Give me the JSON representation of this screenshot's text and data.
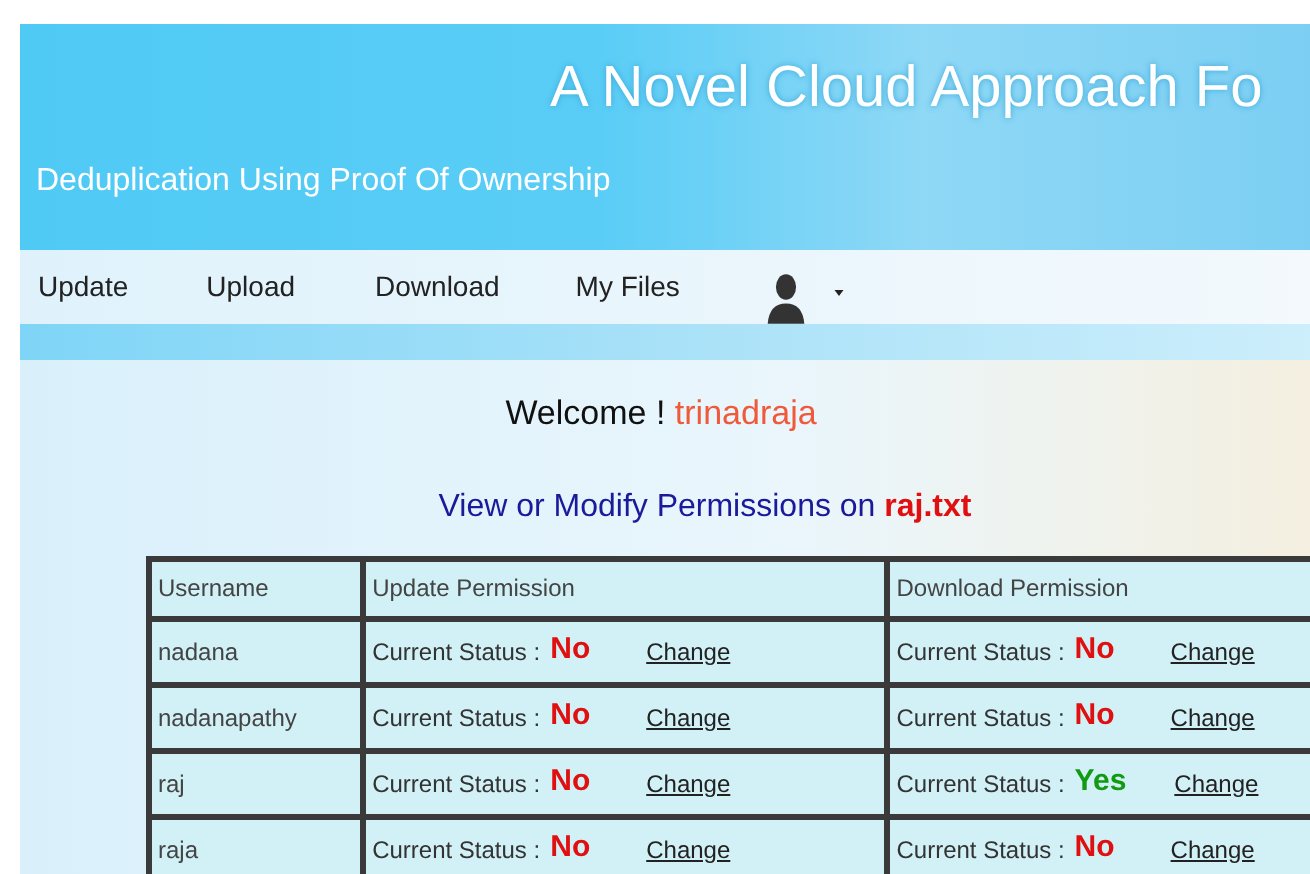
{
  "header": {
    "title": "A Novel Cloud Approach Fo",
    "subtitle": "Deduplication Using Proof Of Ownership"
  },
  "nav": {
    "items": [
      "Update",
      "Upload",
      "Download",
      "My Files"
    ]
  },
  "welcome": {
    "greeting": "Welcome !",
    "username": "trinadraja"
  },
  "heading": {
    "text": "View or Modify Permissions on",
    "file": "raj.txt"
  },
  "table": {
    "columns": [
      "Username",
      "Update Permission",
      "Download Permission"
    ],
    "rows": [
      {
        "username": "nadana",
        "update": {
          "label": "Current Status :",
          "value": "No",
          "granted": false,
          "link": "Change"
        },
        "download": {
          "label": "Current Status :",
          "value": "No",
          "granted": false,
          "link": "Change"
        }
      },
      {
        "username": "nadanapathy",
        "update": {
          "label": "Current Status :",
          "value": "No",
          "granted": false,
          "link": "Change"
        },
        "download": {
          "label": "Current Status :",
          "value": "No",
          "granted": false,
          "link": "Change"
        }
      },
      {
        "username": "raj",
        "update": {
          "label": "Current Status :",
          "value": "No",
          "granted": false,
          "link": "Change"
        },
        "download": {
          "label": "Current Status :",
          "value": "Yes",
          "granted": true,
          "link": "Change"
        }
      },
      {
        "username": "raja",
        "update": {
          "label": "Current Status :",
          "value": "No",
          "granted": false,
          "link": "Change"
        },
        "download": {
          "label": "Current Status :",
          "value": "No",
          "granted": false,
          "link": "Change"
        }
      }
    ]
  }
}
